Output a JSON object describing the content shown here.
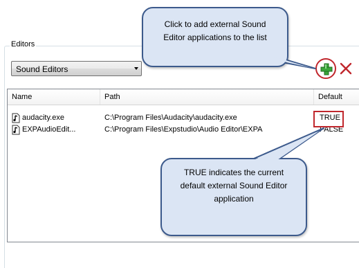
{
  "editors_group": {
    "title": "Editors"
  },
  "dropdown": {
    "selected": "Sound Editors"
  },
  "toolbar": {
    "add_icon": "plus-icon",
    "remove_icon": "x-icon"
  },
  "list": {
    "columns": [
      "Name",
      "Path",
      "Default"
    ],
    "rows": [
      {
        "name": "audacity.exe",
        "path": "C:\\Program Files\\Audacity\\audacity.exe",
        "default": "TRUE"
      },
      {
        "name": "EXPAudioEdit...",
        "path": "C:\\Program Files\\Expstudio\\Audio Editor\\EXPA",
        "default": "FALSE"
      }
    ]
  },
  "callouts": {
    "add": "Click to add external Sound Editor applications to the list",
    "default": "TRUE indicates the current default external Sound Editor application"
  },
  "colors": {
    "highlight": "#c0262c",
    "callout_fill": "#dbe5f4",
    "callout_border": "#3c5a8c"
  }
}
